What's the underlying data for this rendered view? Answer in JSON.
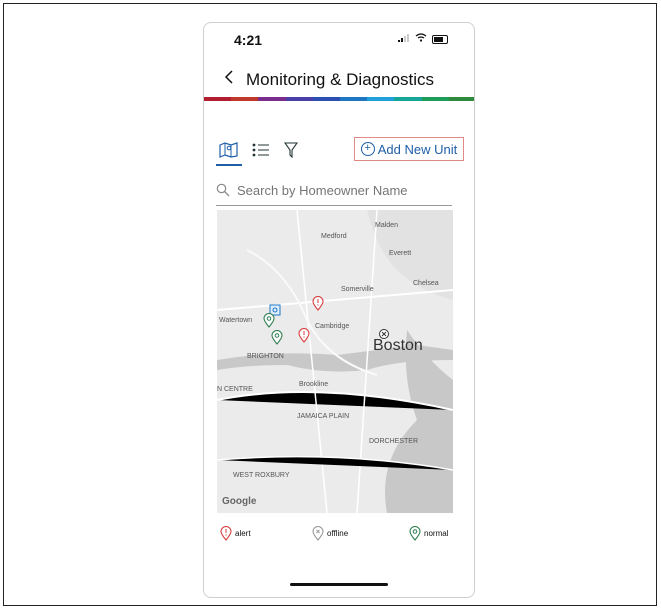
{
  "status": {
    "time": "4:21"
  },
  "header": {
    "title": "Monitoring & Diagnostics",
    "back_icon": "chevron-left-icon"
  },
  "brand_colors": [
    "#b01e2f",
    "#c0392b",
    "#7b2d8e",
    "#4a3ea8",
    "#2b4fb3",
    "#1f77c4",
    "#1fa0d8",
    "#17a599",
    "#1e9d5a",
    "#2e8b3d"
  ],
  "toolbar": {
    "map_view_icon": "map-icon",
    "list_view_icon": "list-icon",
    "filter_icon": "filter-icon",
    "add_label": "Add New Unit"
  },
  "search": {
    "placeholder": "Search by Homeowner Name"
  },
  "map": {
    "labels": [
      "Medford",
      "Malden",
      "Everett",
      "Chelsea",
      "Somerville",
      "Watertown",
      "Cambridge",
      "BRIGHTON",
      "Brookline",
      "N CENTRE",
      "JAMAICA PLAIN",
      "DORCHESTER",
      "WEST ROXBURY"
    ],
    "city": "Boston",
    "attribution": "Google"
  },
  "legend": {
    "alert": "alert",
    "offline": "offline",
    "normal": "normal"
  },
  "colors": {
    "alert": "#d63c3c",
    "offline": "#999999",
    "normal": "#2e7d4f",
    "accent": "#1f5fa8"
  }
}
